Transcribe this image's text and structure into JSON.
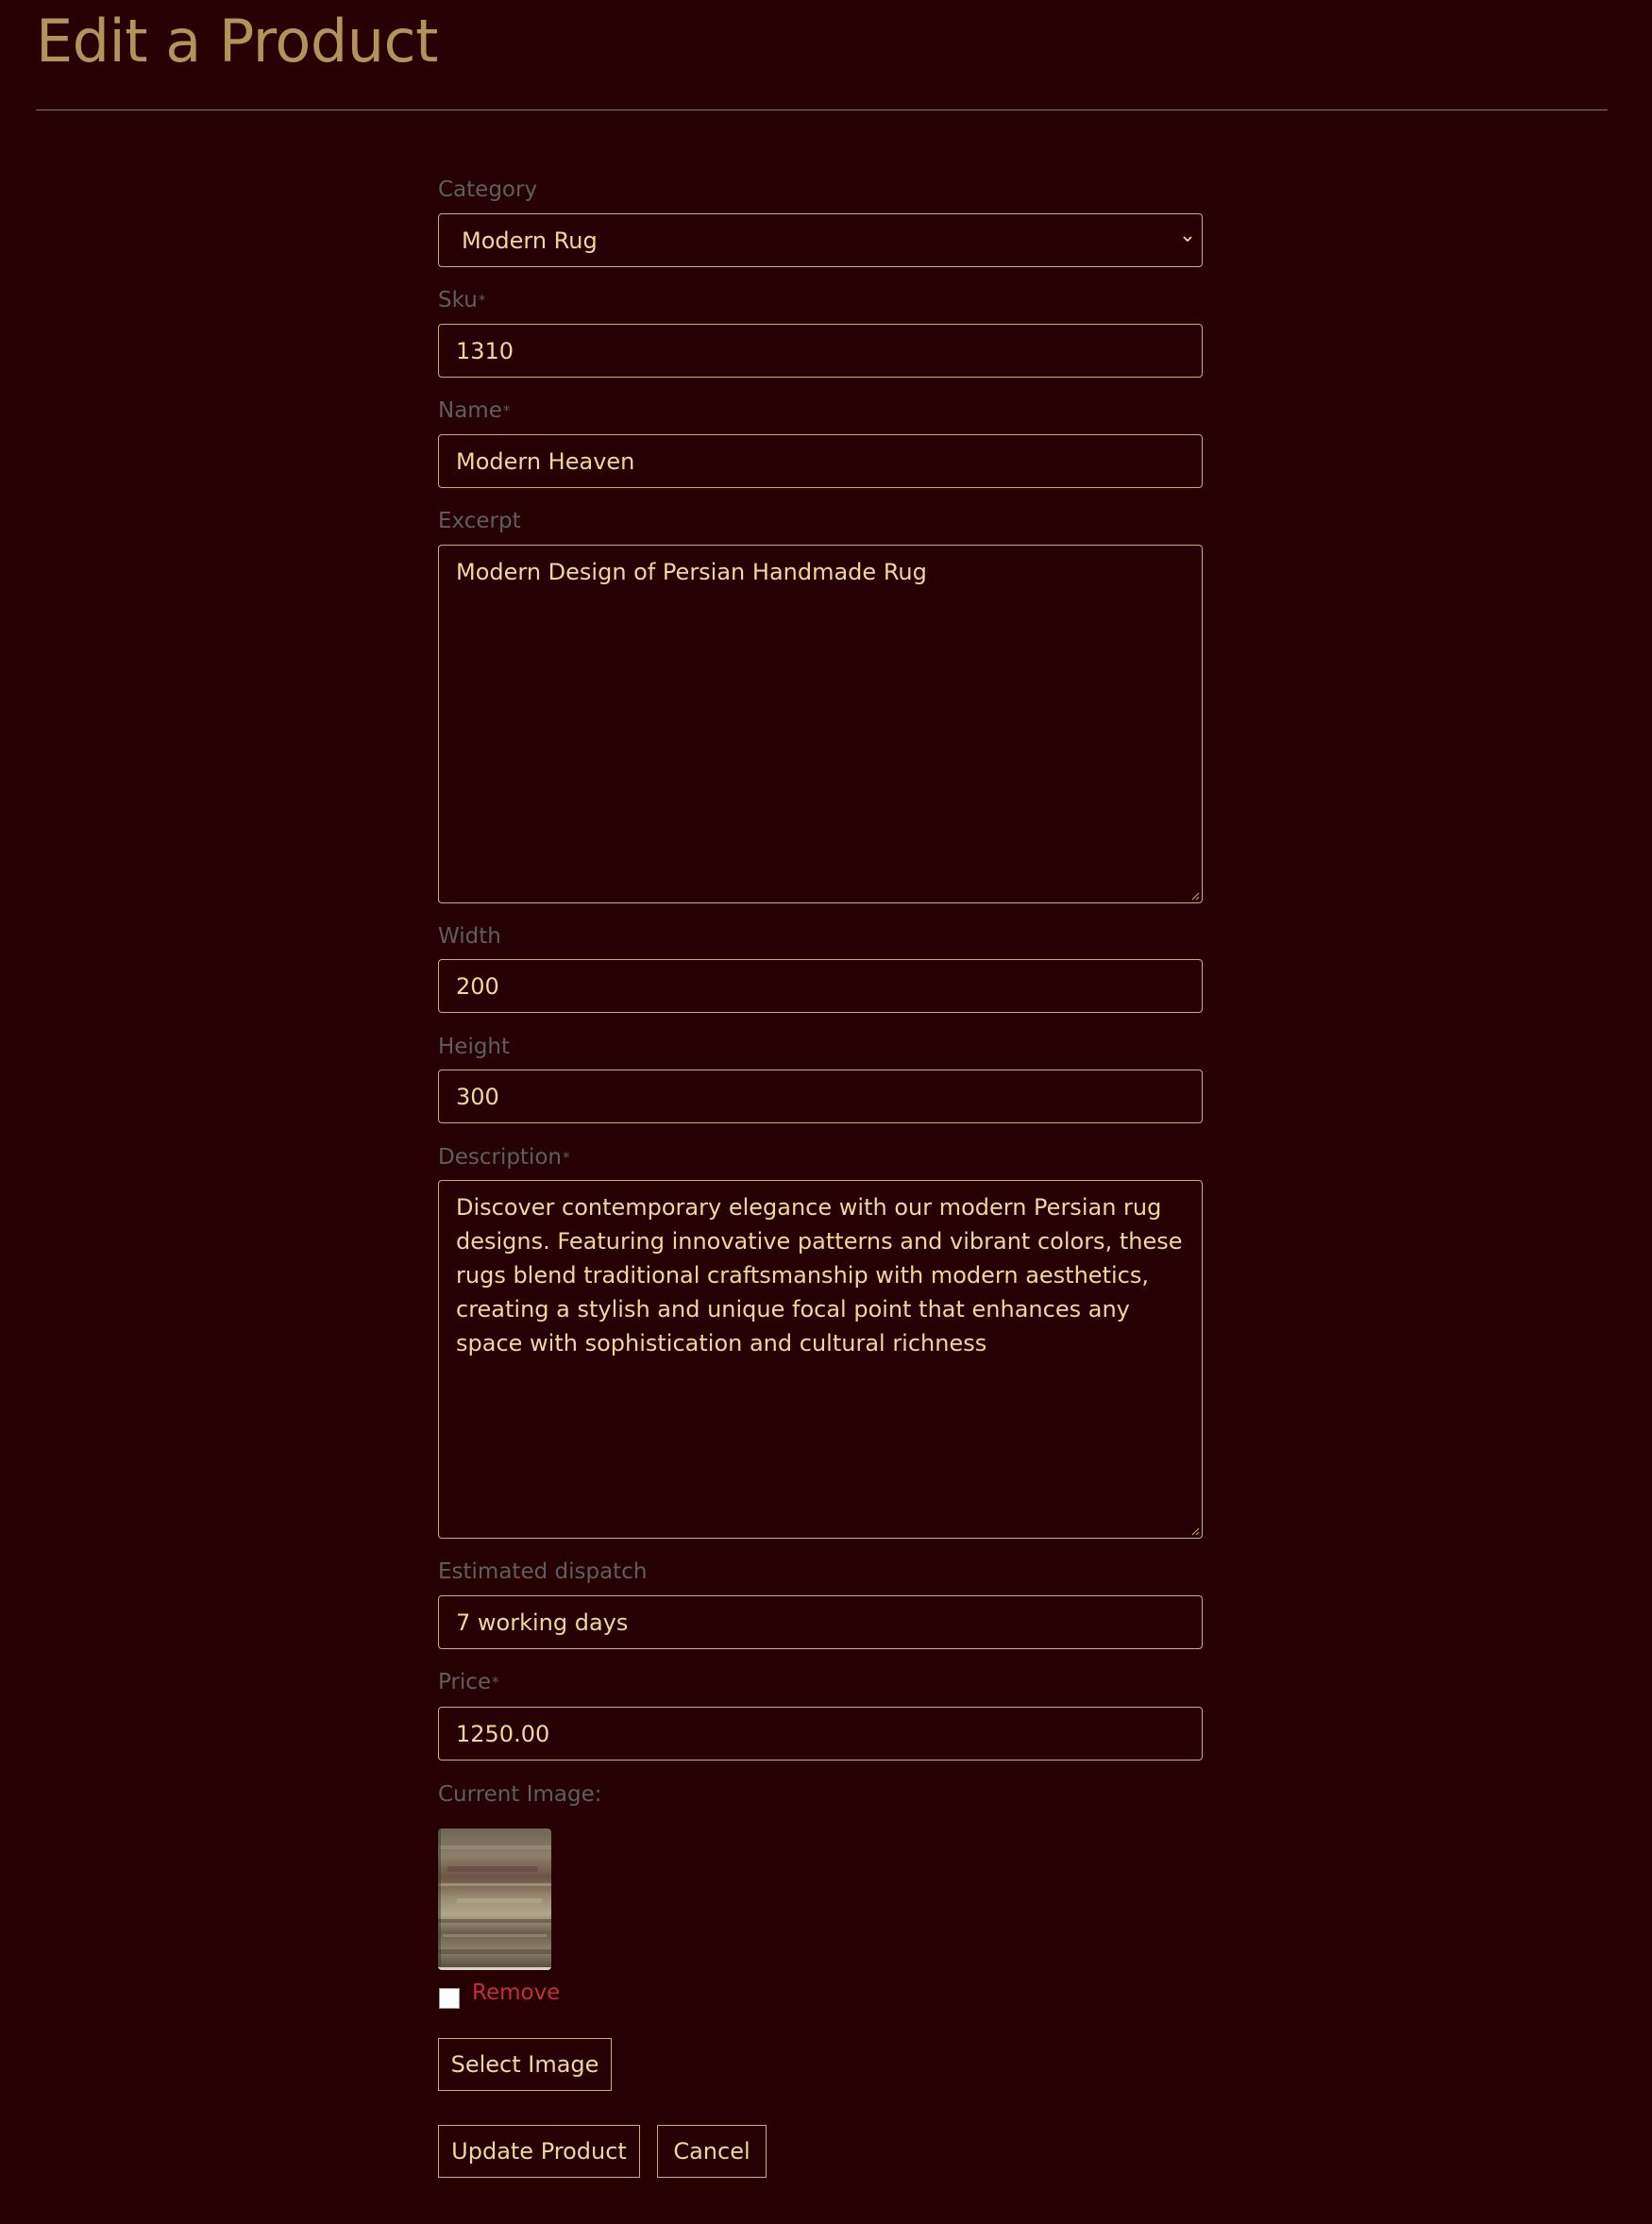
{
  "page": {
    "title": "Edit a Product"
  },
  "form": {
    "category": {
      "label": "Category",
      "value": "Modern Rug"
    },
    "sku": {
      "label": "Sku",
      "required_mark": "*",
      "value": "1310"
    },
    "name": {
      "label": "Name",
      "required_mark": "*",
      "value": "Modern Heaven"
    },
    "excerpt": {
      "label": "Excerpt",
      "value": "Modern Design of Persian Handmade Rug"
    },
    "width": {
      "label": "Width",
      "value": "200"
    },
    "height": {
      "label": "Height",
      "value": "300"
    },
    "description": {
      "label": "Description",
      "required_mark": "*",
      "value": "Discover contemporary elegance with our modern Persian rug designs. Featuring innovative patterns and vibrant colors, these rugs blend traditional craftsmanship with modern aesthetics, creating a stylish and unique focal point that enhances any space with sophistication and cultural richness"
    },
    "dispatch": {
      "label": "Estimated dispatch",
      "value": "7 working days"
    },
    "price": {
      "label": "Price",
      "required_mark": "*",
      "value": "1250.00"
    },
    "image": {
      "label": "Current Image:",
      "remove_label": "Remove",
      "remove_checked": false,
      "select_button": "Select Image"
    },
    "actions": {
      "update_button": "Update Product",
      "cancel_button": "Cancel"
    }
  },
  "colors": {
    "background": "#260003",
    "title": "#b3935a",
    "label": "#5e5e5e",
    "field_text": "#f1d79a",
    "field_border": "#c9ad78",
    "remove_text": "#c0303f"
  },
  "icons": {
    "select_arrow": "chevron-down-icon",
    "resize_handle": "resize-grip-icon"
  }
}
